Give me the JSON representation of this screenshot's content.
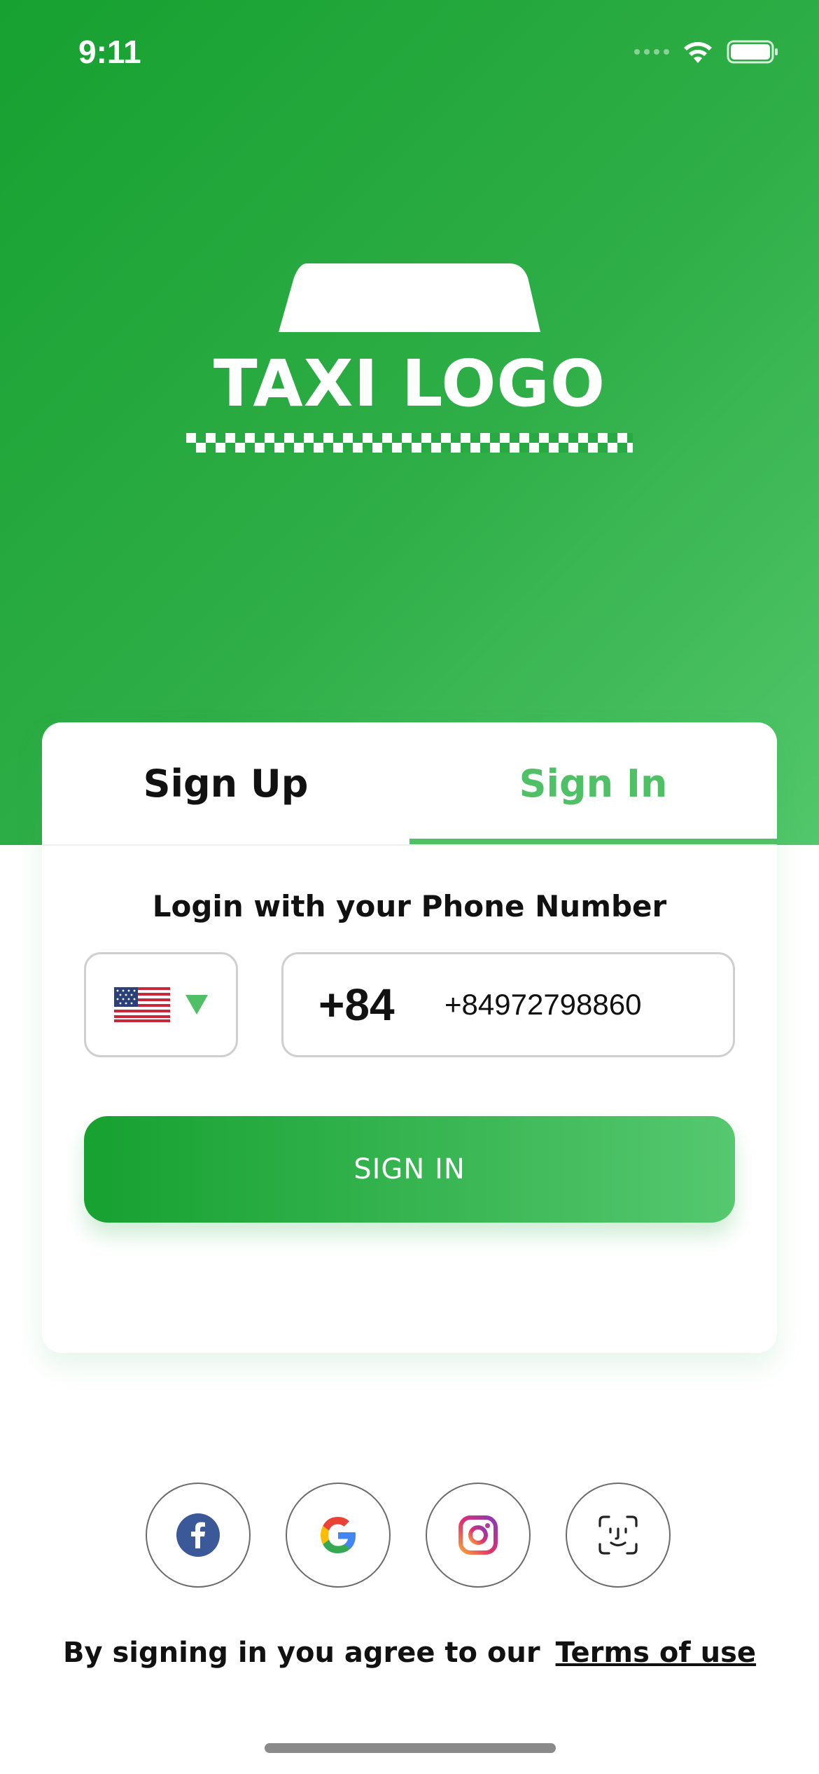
{
  "status_bar": {
    "time": "9:11"
  },
  "logo": {
    "text": "TAXI LOGO"
  },
  "tabs": [
    {
      "label": "Sign Up",
      "active": false
    },
    {
      "label": "Sign In",
      "active": true
    }
  ],
  "form": {
    "title": "Login with your Phone Number",
    "country_flag": "us-flag-icon",
    "country_code": "+84",
    "phone_value": "+84972798860",
    "submit_label": "SIGN IN"
  },
  "social": [
    {
      "name": "facebook-icon"
    },
    {
      "name": "google-icon"
    },
    {
      "name": "instagram-icon"
    },
    {
      "name": "face-id-icon"
    }
  ],
  "footer": {
    "terms_prefix": "By signing in you agree to our",
    "terms_link": "Terms of use"
  },
  "colors": {
    "brand_green": "#16a130",
    "accent_green": "#4fc066"
  }
}
